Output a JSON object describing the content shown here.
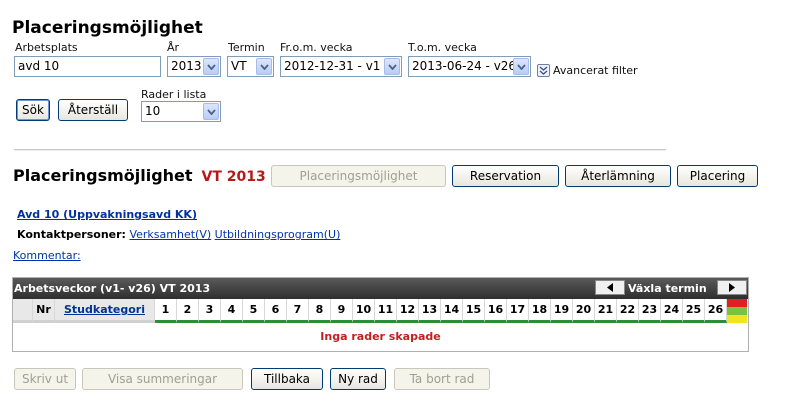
{
  "filter": {
    "title": "Placeringsmöjlighet",
    "arbetsplats_label": "Arbetsplats",
    "arbetsplats_value": "avd 10",
    "ar_label": "År",
    "ar_value": "2013",
    "termin_label": "Termin",
    "termin_value": "VT",
    "from_label": "Fr.o.m. vecka",
    "from_value": "2012-12-31 - v1",
    "tom_label": "T.o.m. vecka",
    "tom_value": "2013-06-24 - v26",
    "advanced_label": "Avancerat filter",
    "rows_label": "Rader i lista",
    "rows_value": "10",
    "search_button": "Sök",
    "reset_button": "Återställ"
  },
  "section": {
    "title": "Placeringsmöjlighet",
    "term": "VT 2013",
    "tabs": [
      {
        "label": "Placeringsmöjlighet",
        "disabled": true
      },
      {
        "label": "Reservation",
        "disabled": false
      },
      {
        "label": "Återlämning",
        "disabled": false
      },
      {
        "label": "Placering",
        "disabled": false
      }
    ]
  },
  "unit": {
    "name": "Avd 10 (Uppvakningsavd KK)",
    "contacts_label": "Kontaktpersoner:",
    "contact_links": [
      "Verksamhet(V)",
      "Utbildningsprogram(U)"
    ],
    "comment_link": "Kommentar:"
  },
  "grid": {
    "header_title": "Arbetsveckor (v1- v26) VT 2013",
    "switch_term_label": "Växla termin",
    "nr_header": "Nr",
    "category_header": "Studkategori",
    "weeks": [
      "1",
      "2",
      "3",
      "4",
      "5",
      "6",
      "7",
      "8",
      "9",
      "10",
      "11",
      "12",
      "13",
      "14",
      "15",
      "16",
      "17",
      "18",
      "19",
      "20",
      "21",
      "22",
      "23",
      "24",
      "25",
      "26"
    ],
    "empty_message": "Inga rader skapade",
    "legend_colors": [
      "#e02020",
      "#7cc242",
      "#f2e422"
    ]
  },
  "footer": {
    "buttons": [
      {
        "label": "Skriv ut",
        "disabled": true
      },
      {
        "label": "Visa summeringar",
        "disabled": true
      },
      {
        "label": "Tillbaka",
        "disabled": false
      },
      {
        "label": "Ny rad",
        "disabled": false
      },
      {
        "label": "Ta bort rad",
        "disabled": true
      }
    ]
  }
}
